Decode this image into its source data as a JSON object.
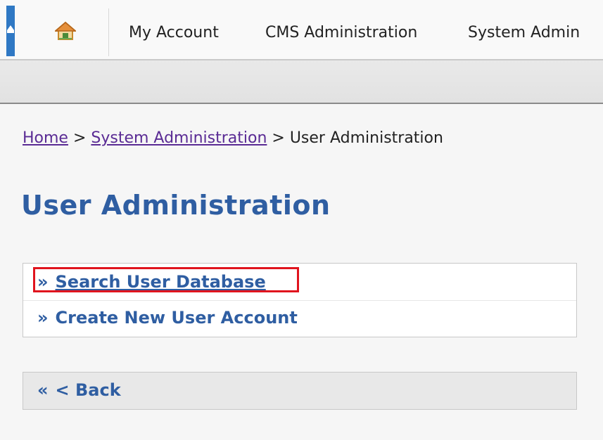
{
  "nav": {
    "items": [
      {
        "label": "My Account"
      },
      {
        "label": "CMS Administration"
      },
      {
        "label": "System Admin"
      }
    ]
  },
  "breadcrumb": {
    "home": "Home",
    "sep1": " > ",
    "system_admin": "System Administration",
    "sep2": " > ",
    "current": "User Administration"
  },
  "page": {
    "title": "User Administration"
  },
  "actions": {
    "items": [
      {
        "prefix": "»",
        "label": "Search User Database"
      },
      {
        "prefix": "»",
        "label": "Create New User Account"
      }
    ]
  },
  "back": {
    "prefix": "«",
    "label": "< Back"
  },
  "colors": {
    "accent": "#2f5ea2",
    "highlight": "#e0141e",
    "visited_link": "#5a2b94"
  }
}
